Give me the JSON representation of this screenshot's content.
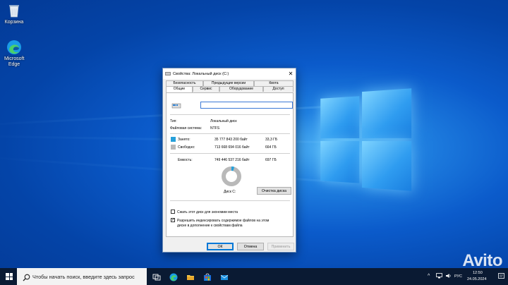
{
  "desktop": {
    "icons": [
      {
        "label": "Корзина"
      },
      {
        "label": "Microsoft Edge"
      }
    ]
  },
  "dialog": {
    "title": "Свойства: Локальный диск (C:)",
    "tabs_row1": [
      "Безопасность",
      "Предыдущие версии",
      "Квота"
    ],
    "tabs_row2": [
      "Общие",
      "Сервис",
      "Оборудование",
      "Доступ"
    ],
    "active_tab": "Общие",
    "drive_name_value": "",
    "type_label": "Тип:",
    "type_value": "Локальный диск",
    "fs_label": "Файловая система:",
    "fs_value": "NTFS",
    "used": {
      "label": "Занято:",
      "bytes": "35 777 843 200 байт",
      "size": "33,3 ГБ",
      "color": "#26a0da"
    },
    "free": {
      "label": "Свободно:",
      "bytes": "713 668 694 016 байт",
      "size": "664 ГБ",
      "color": "#b9b9b9"
    },
    "capacity": {
      "label": "Емкость:",
      "bytes": "749 446 537 216 байт",
      "size": "697 ГБ"
    },
    "used_fraction": 0.048,
    "disk_label": "Диск C:",
    "cleanup_button": "Очистка диска",
    "compress_label": "Сжать этот диск для экономии места",
    "compress_checked": false,
    "index_label_line1": "Разрешить индексировать содержимое файлов на этом",
    "index_label_line2": "диске в дополнение к свойствам файла",
    "index_checked": true,
    "ok_button": "ОК",
    "cancel_button": "Отмена",
    "apply_button": "Применить"
  },
  "taskbar": {
    "search_placeholder": "Чтобы начать поиск, введите здесь запрос",
    "language": "РУС",
    "time": "12:50",
    "date": "24.05.2024"
  },
  "watermark": "Avito"
}
